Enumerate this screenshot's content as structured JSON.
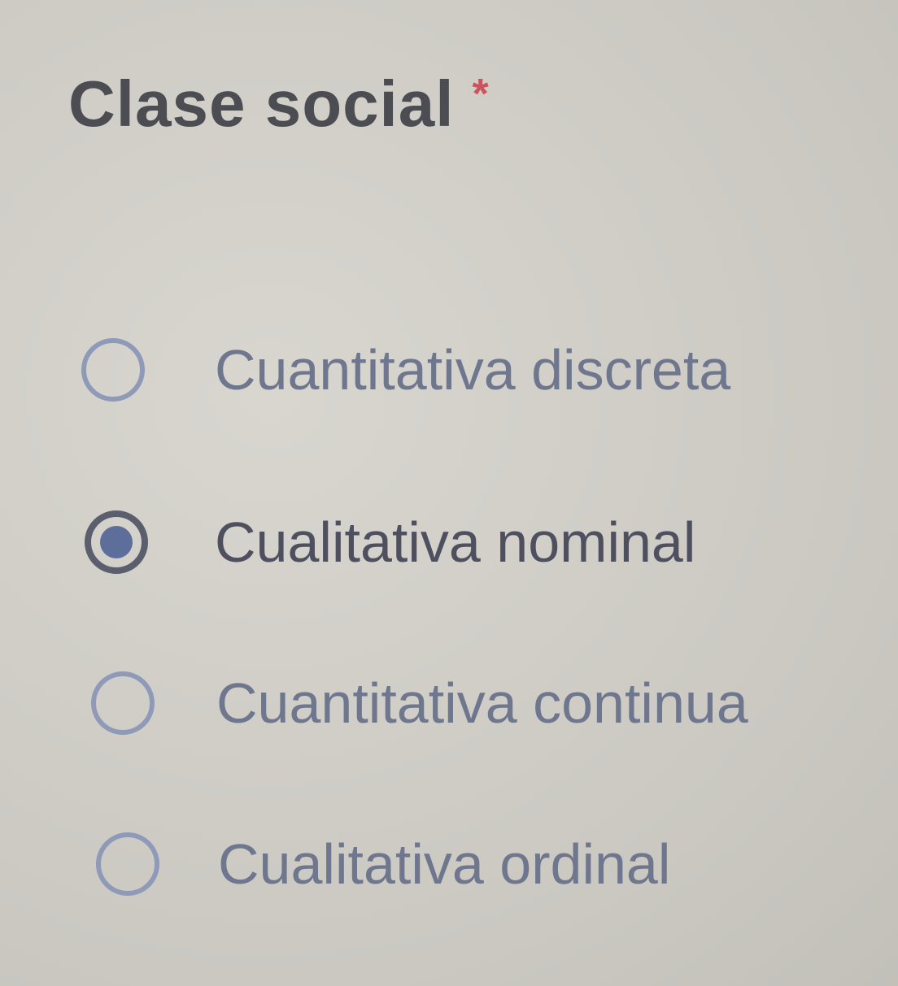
{
  "question": {
    "title": "Clase social",
    "required_marker": "*",
    "selected_index": 1,
    "options": [
      {
        "label": "Cuantitativa discreta",
        "checked": false
      },
      {
        "label": "Cualitativa nominal",
        "checked": true
      },
      {
        "label": "Cuantitativa continua",
        "checked": false
      },
      {
        "label": "Cualitativa ordinal",
        "checked": false
      }
    ]
  },
  "colors": {
    "background": "#cfcdc6",
    "title": "#4b4d52",
    "required": "#c9545d",
    "radio_border": "#8e9ab8",
    "radio_selected_dot": "#5e6e9a",
    "option_text": "#6f778e"
  }
}
